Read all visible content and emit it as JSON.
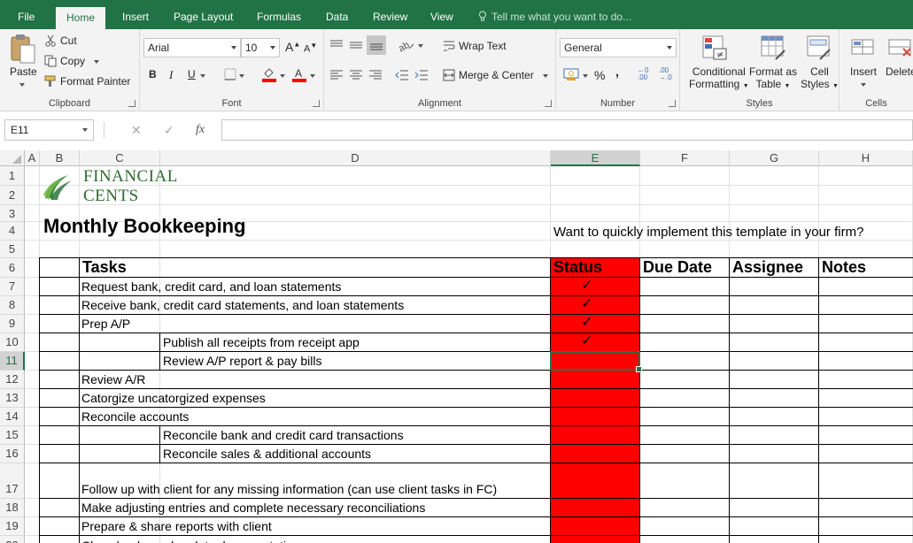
{
  "menu": {
    "tabs": [
      "File",
      "Home",
      "Insert",
      "Page Layout",
      "Formulas",
      "Data",
      "Review",
      "View"
    ],
    "tell_me": "Tell me what you want to do..."
  },
  "ribbon": {
    "clipboard": {
      "paste": "Paste",
      "cut": "Cut",
      "copy": "Copy",
      "format_painter": "Format Painter",
      "label": "Clipboard"
    },
    "font": {
      "name": "Arial",
      "size": "10",
      "label": "Font"
    },
    "alignment": {
      "wrap_text": "Wrap Text",
      "merge_center": "Merge & Center",
      "label": "Alignment"
    },
    "number": {
      "format": "General",
      "label": "Number"
    },
    "styles": {
      "conditional_1": "Conditional",
      "conditional_2": "Formatting",
      "format_as_1": "Format as",
      "format_as_2": "Table",
      "cell_styles_1": "Cell",
      "cell_styles_2": "Styles",
      "label": "Styles"
    },
    "cells": {
      "insert": "Insert",
      "delete": "Delete",
      "label": "Cells"
    }
  },
  "formula_bar": {
    "name_box": "E11",
    "value": ""
  },
  "columns": [
    "A",
    "B",
    "C",
    "D",
    "E",
    "F",
    "G",
    "H"
  ],
  "selected_column": "E",
  "rows": [
    "1",
    "2",
    "3",
    "4",
    "5",
    "6",
    "7",
    "8",
    "9",
    "10",
    "11",
    "12",
    "13",
    "14",
    "15",
    "16",
    "17",
    "18",
    "19",
    "20"
  ],
  "selected_row": "11",
  "sheet": {
    "logo_line1": "FINANCIAL",
    "logo_line2": "CENTS",
    "title": "Monthly Bookkeeping",
    "promo": "Want to quickly implement this template in your firm?",
    "headers": {
      "tasks": "Tasks",
      "status": "Status",
      "due_date": "Due Date",
      "assignee": "Assignee",
      "notes": "Notes"
    },
    "tasks": [
      {
        "row": "7",
        "text": "Request bank, credit card, and loan statements",
        "indent": false,
        "done": true
      },
      {
        "row": "8",
        "text": "Receive bank, credit card statements, and loan statements",
        "indent": false,
        "done": true
      },
      {
        "row": "9",
        "text": "Prep A/P",
        "indent": false,
        "done": true
      },
      {
        "row": "10",
        "text": "Publish all receipts from receipt app",
        "indent": true,
        "done": true
      },
      {
        "row": "11",
        "text": "Review A/P report & pay bills",
        "indent": true,
        "done": false
      },
      {
        "row": "12",
        "text": "Review A/R",
        "indent": false,
        "done": false
      },
      {
        "row": "13",
        "text": "Catorgize uncatorgized expenses",
        "indent": false,
        "done": false
      },
      {
        "row": "14",
        "text": "Reconcile accounts",
        "indent": false,
        "done": false
      },
      {
        "row": "15",
        "text": "Reconcile bank and credit card transactions",
        "indent": true,
        "done": false
      },
      {
        "row": "16",
        "text": "Reconcile sales & additional accounts",
        "indent": true,
        "done": false
      },
      {
        "row": "17",
        "text": "Follow up with client for any missing information (can use client tasks in FC)",
        "indent": false,
        "done": false
      },
      {
        "row": "18",
        "text": "Make adjusting entries and complete necessary reconciliations",
        "indent": false,
        "done": false
      },
      {
        "row": "19",
        "text": "Prepare & share reports with client",
        "indent": false,
        "done": false
      },
      {
        "row": "20",
        "text": "Close books and update documentation",
        "indent": false,
        "done": false
      }
    ],
    "check_mark": "✓",
    "status_color": "#ff0000",
    "accent_color": "#217346"
  }
}
